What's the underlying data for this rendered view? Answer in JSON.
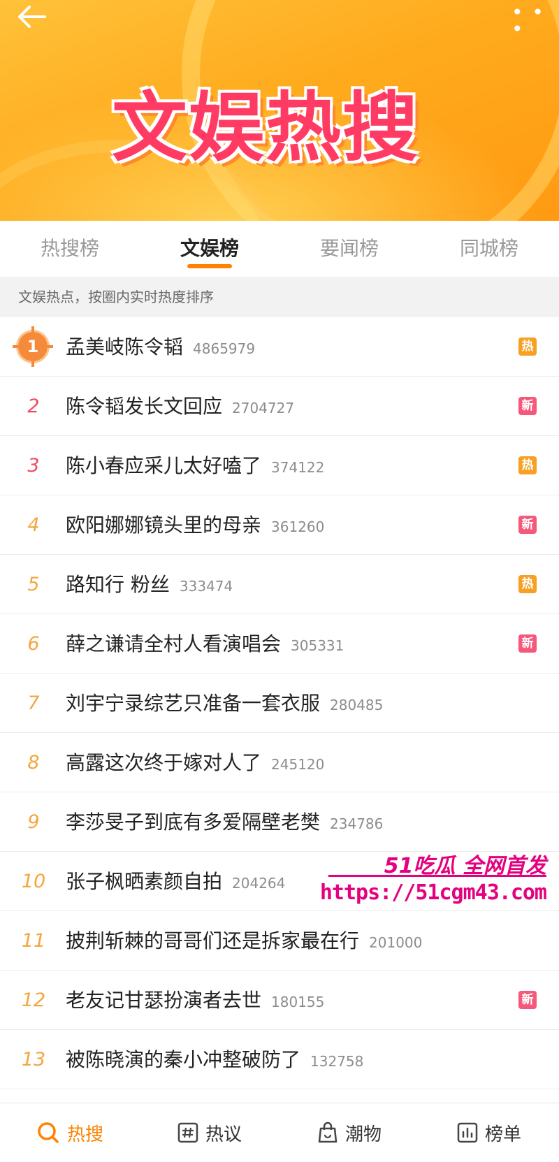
{
  "header": {
    "banner_title": "文娱热搜",
    "more_label": "• • •"
  },
  "tabs": [
    {
      "label": "热搜榜",
      "active": false
    },
    {
      "label": "文娱榜",
      "active": true
    },
    {
      "label": "要闻榜",
      "active": false
    },
    {
      "label": "同城榜",
      "active": false
    }
  ],
  "subtitle": "文娱热点，按圈内实时热度排序",
  "list": [
    {
      "rank": "1",
      "title": "孟美岐陈令韬",
      "count": "4865979",
      "tag": "热"
    },
    {
      "rank": "2",
      "title": "陈令韬发长文回应",
      "count": "2704727",
      "tag": "新"
    },
    {
      "rank": "3",
      "title": "陈小春应采儿太好嗑了",
      "count": "374122",
      "tag": "热"
    },
    {
      "rank": "4",
      "title": "欧阳娜娜镜头里的母亲",
      "count": "361260",
      "tag": "新"
    },
    {
      "rank": "5",
      "title": "路知行 粉丝",
      "count": "333474",
      "tag": "热"
    },
    {
      "rank": "6",
      "title": "薛之谦请全村人看演唱会",
      "count": "305331",
      "tag": "新"
    },
    {
      "rank": "7",
      "title": "刘宇宁录综艺只准备一套衣服",
      "count": "280485",
      "tag": ""
    },
    {
      "rank": "8",
      "title": "高露这次终于嫁对人了",
      "count": "245120",
      "tag": ""
    },
    {
      "rank": "9",
      "title": "李莎旻子到底有多爱隔壁老樊",
      "count": "234786",
      "tag": ""
    },
    {
      "rank": "10",
      "title": "张子枫晒素颜自拍",
      "count": "204264",
      "tag": ""
    },
    {
      "rank": "11",
      "title": "披荆斩棘的哥哥们还是拆家最在行",
      "count": "201000",
      "tag": ""
    },
    {
      "rank": "12",
      "title": "老友记甘瑟扮演者去世",
      "count": "180155",
      "tag": "新"
    },
    {
      "rank": "13",
      "title": "被陈晓演的秦小冲整破防了",
      "count": "132758",
      "tag": ""
    }
  ],
  "watermark": {
    "top": "51吃瓜 全网首发",
    "url": "https://51cgm43.com"
  },
  "bottom_nav": [
    {
      "label": "热搜",
      "icon": "search-icon",
      "active": true
    },
    {
      "label": "热议",
      "icon": "hashtag-icon",
      "active": false
    },
    {
      "label": "潮物",
      "icon": "shopping-bag-icon",
      "active": false
    },
    {
      "label": "榜单",
      "icon": "bar-chart-icon",
      "active": false
    }
  ],
  "colors": {
    "accent": "#ff8200",
    "hot": "#f7a023",
    "new": "#f5587a",
    "rank_top": "#f04a60",
    "rank_other": "#f4a640"
  }
}
